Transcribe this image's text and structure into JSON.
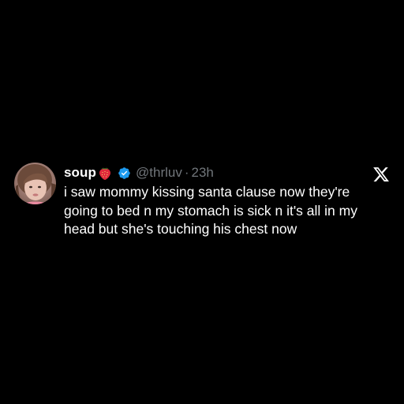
{
  "tweet": {
    "display_name": "soup",
    "handle": "@thrluv",
    "separator": "·",
    "time": "23h",
    "text": "i saw mommy kissing santa clause now they're going to bed n my stomach is sick n it's all in my head but she's touching his chest now"
  },
  "icons": {
    "name_emoji": "strawberry-icon",
    "verified": "verified-badge-icon",
    "platform": "x-logo-icon"
  },
  "colors": {
    "background": "#000000",
    "text": "#ffffff",
    "secondary": "#71767b",
    "verified": "#1d9bf0",
    "strawberry": "#e0283c"
  }
}
